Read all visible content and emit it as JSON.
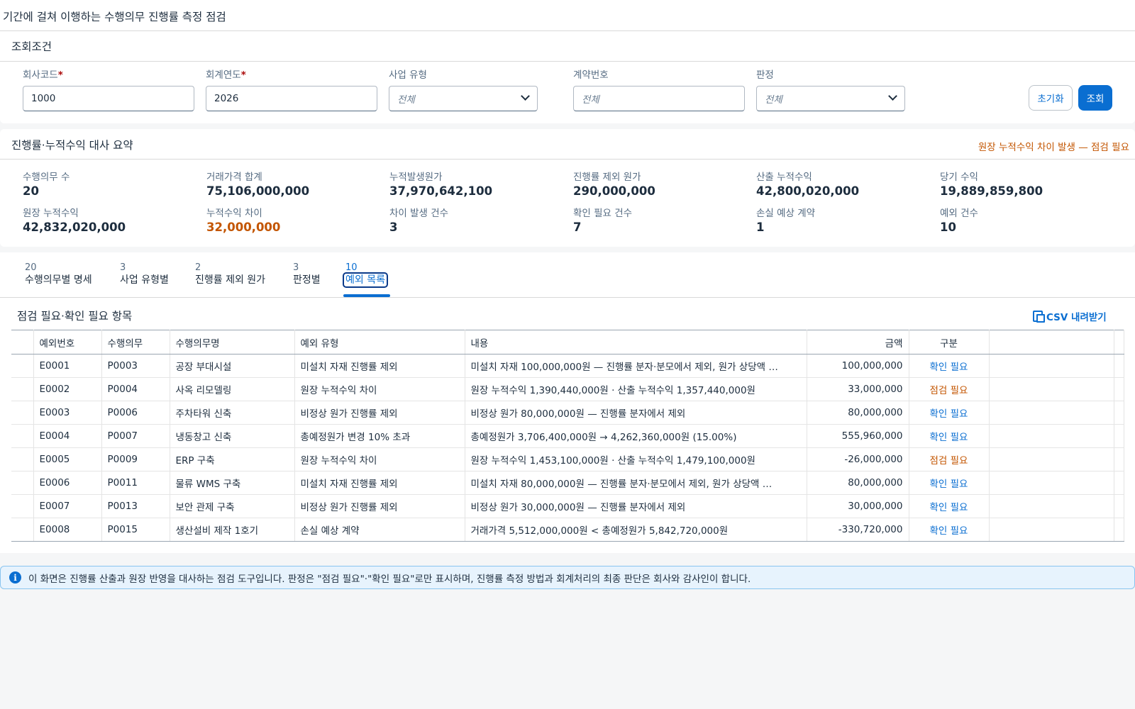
{
  "page": {
    "title": "기간에 걸쳐 이행하는 수행의무 진행률 측정 점검"
  },
  "conditions": {
    "title": "조회조건",
    "fields": [
      {
        "label": "회사코드",
        "required": true,
        "value": "1000"
      },
      {
        "label": "회계연도",
        "required": true,
        "value": "2026"
      },
      {
        "label": "사업 유형",
        "required": false,
        "placeholder": "전체",
        "type": "select"
      },
      {
        "label": "계약번호",
        "required": false,
        "placeholder": "전체",
        "type": "input"
      },
      {
        "label": "판정",
        "required": false,
        "placeholder": "전체",
        "type": "select"
      }
    ],
    "reset_label": "초기화",
    "search_label": "조회"
  },
  "summary": {
    "title": "진행률·누적수익 대사 요약",
    "warning": "원장 누적수익 차이 발생 — 점검 필요",
    "kpis": [
      {
        "label": "수행의무 수",
        "value": "20"
      },
      {
        "label": "거래가격 합계",
        "value": "75,106,000,000"
      },
      {
        "label": "누적발생원가",
        "value": "37,970,642,100"
      },
      {
        "label": "진행률 제외 원가",
        "value": "290,000,000"
      },
      {
        "label": "산출 누적수익",
        "value": "42,800,020,000"
      },
      {
        "label": "당기 수익",
        "value": "19,889,859,800"
      },
      {
        "label": "원장 누적수익",
        "value": "42,832,020,000"
      },
      {
        "label": "누적수익 차이",
        "value": "32,000,000",
        "warn": true
      },
      {
        "label": "차이 발생 건수",
        "value": "3"
      },
      {
        "label": "확인 필요 건수",
        "value": "7"
      },
      {
        "label": "손실 예상 계약",
        "value": "1"
      },
      {
        "label": "예외 건수",
        "value": "10"
      }
    ]
  },
  "tabs": [
    {
      "count": "20",
      "label": "수행의무별 명세"
    },
    {
      "count": "3",
      "label": "사업 유형별"
    },
    {
      "count": "2",
      "label": "진행률 제외 원가"
    },
    {
      "count": "3",
      "label": "판정별"
    },
    {
      "count": "10",
      "label": "예외 목록",
      "active": true
    }
  ],
  "exceptions": {
    "title": "점검 필요·확인 필요 항목",
    "csv_label": "CSV 내려받기",
    "columns": [
      "예외번호",
      "수행의무",
      "수행의무명",
      "예외 유형",
      "내용",
      "금액",
      "구분"
    ],
    "rows": [
      {
        "id": "E0001",
        "po": "P0003",
        "name": "공장 부대시설",
        "type": "미설치 자재 진행률 제외",
        "desc": "미설치 자재 100,000,000원 — 진행률 분자·분모에서 제외, 원가 상당액 …",
        "amount": "100,000,000",
        "status": "확인 필요"
      },
      {
        "id": "E0002",
        "po": "P0004",
        "name": "사옥 리모델링",
        "type": "원장 누적수익 차이",
        "desc": "원장 누적수익 1,390,440,000원 · 산출 누적수익 1,357,440,000원",
        "amount": "33,000,000",
        "status": "점검 필요"
      },
      {
        "id": "E0003",
        "po": "P0006",
        "name": "주차타워 신축",
        "type": "비정상 원가 진행률 제외",
        "desc": "비정상 원가 80,000,000원 — 진행률 분자에서 제외",
        "amount": "80,000,000",
        "status": "확인 필요"
      },
      {
        "id": "E0004",
        "po": "P0007",
        "name": "냉동창고 신축",
        "type": "총예정원가 변경 10% 초과",
        "desc": "총예정원가 3,706,400,000원 → 4,262,360,000원 (15.00%)",
        "amount": "555,960,000",
        "status": "확인 필요"
      },
      {
        "id": "E0005",
        "po": "P0009",
        "name": "ERP 구축",
        "type": "원장 누적수익 차이",
        "desc": "원장 누적수익 1,453,100,000원 · 산출 누적수익 1,479,100,000원",
        "amount": "-26,000,000",
        "status": "점검 필요"
      },
      {
        "id": "E0006",
        "po": "P0011",
        "name": "물류 WMS 구축",
        "type": "미설치 자재 진행률 제외",
        "desc": "미설치 자재 80,000,000원 — 진행률 분자·분모에서 제외, 원가 상당액 …",
        "amount": "80,000,000",
        "status": "확인 필요"
      },
      {
        "id": "E0007",
        "po": "P0013",
        "name": "보안 관제 구축",
        "type": "비정상 원가 진행률 제외",
        "desc": "비정상 원가 30,000,000원 — 진행률 분자에서 제외",
        "amount": "30,000,000",
        "status": "확인 필요"
      },
      {
        "id": "E0008",
        "po": "P0015",
        "name": "생산설비 제작 1호기",
        "type": "손실 예상 계약",
        "desc": "거래가격 5,512,000,000원 < 총예정원가 5,842,720,000원",
        "amount": "-330,720,000",
        "status": "확인 필요"
      }
    ]
  },
  "info": {
    "text": "이 화면은 진행률 산출과 원장 반영을 대사하는 점검 도구입니다. 판정은 \"점검 필요\"·\"확인 필요\"로만 표시하며, 진행률 측정 방법과 회계처리의 최종 판단은 회사와 감사인이 합니다."
  },
  "colors": {
    "accent": "#0a6ed1",
    "warning": "#c35500",
    "required": "#aa0808",
    "info_bg": "#e7f3fd"
  },
  "icons": {
    "select": "chevron-down-icon",
    "csv": "spreadsheet-icon",
    "info": "info-icon"
  }
}
